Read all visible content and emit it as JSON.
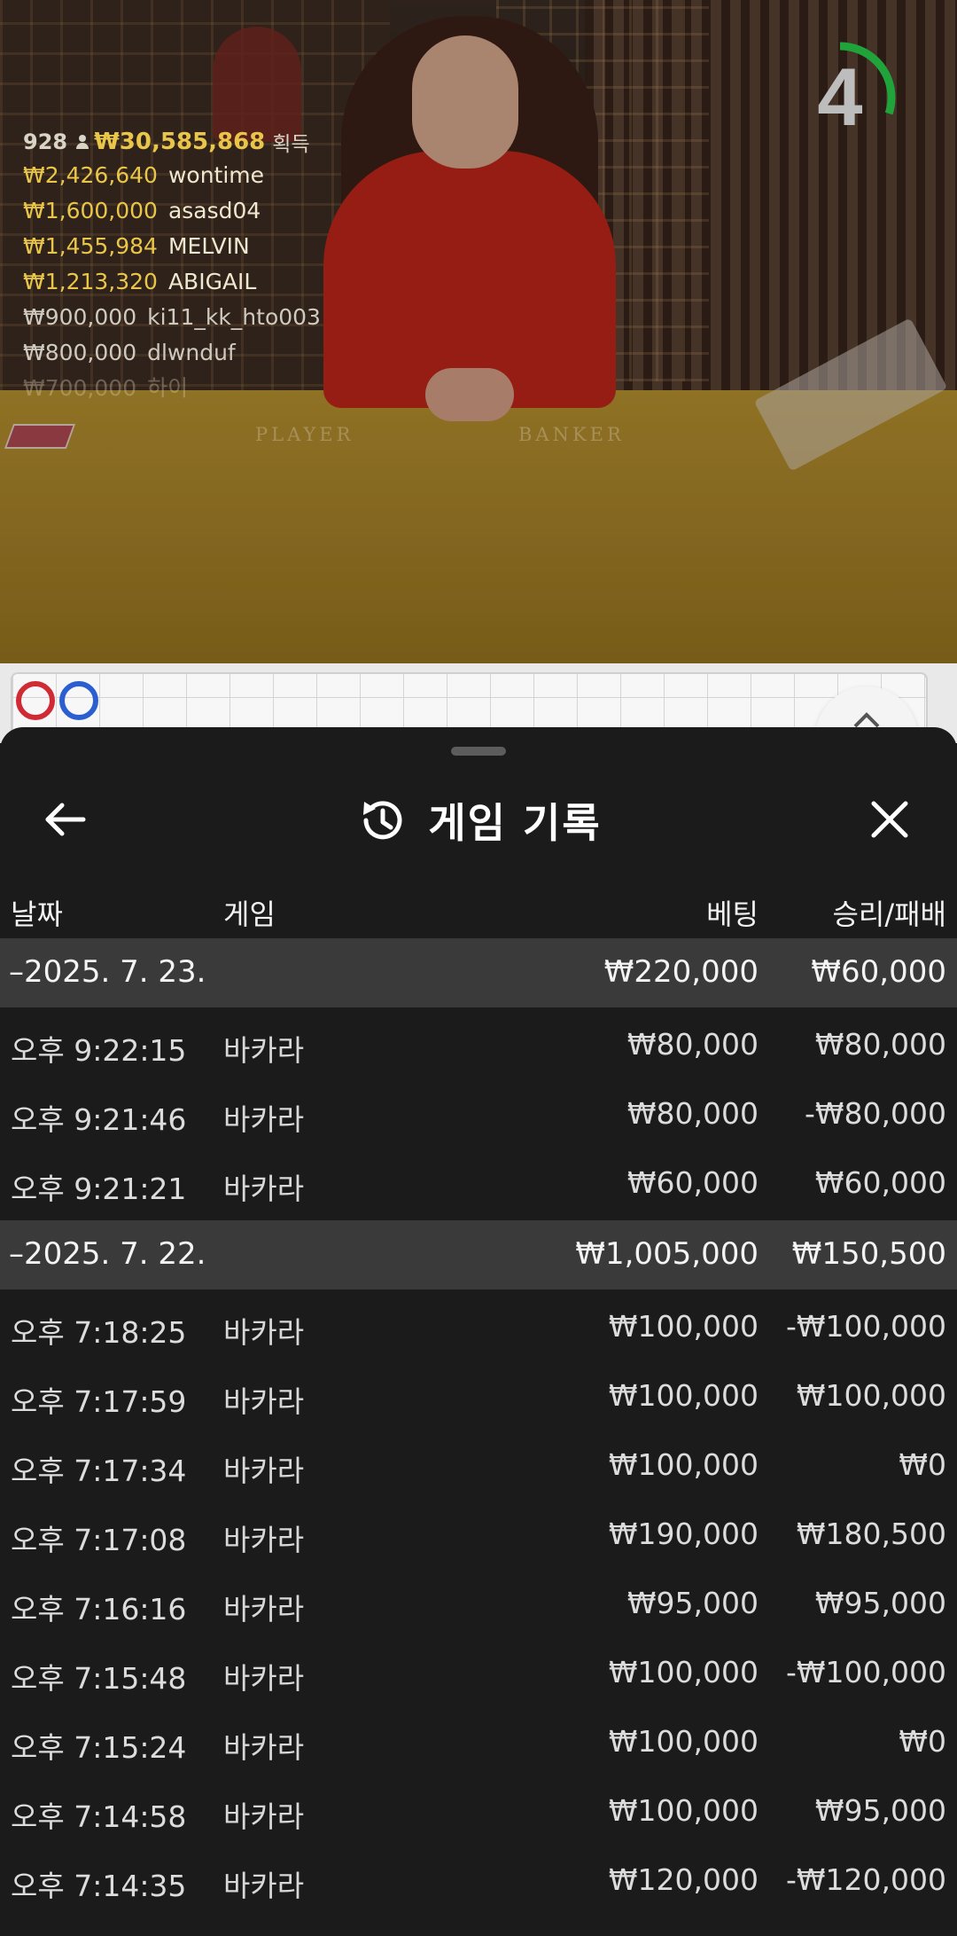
{
  "live": {
    "winners_count": "928",
    "winners_total": "₩30,585,868",
    "winners_suffix": "획득",
    "winners": [
      {
        "amount": "₩2,426,640",
        "name": "wontime"
      },
      {
        "amount": "₩1,600,000",
        "name": "asasd04"
      },
      {
        "amount": "₩1,455,984",
        "name": "MELVIN"
      },
      {
        "amount": "₩1,213,320",
        "name": "ABIGAIL"
      },
      {
        "amount": "₩900,000",
        "name": "ki11_kk_hto003"
      },
      {
        "amount": "₩800,000",
        "name": "dlwnduf"
      },
      {
        "amount": "₩700,000",
        "name": "하이"
      }
    ],
    "timer": "4",
    "timer_progress": 0.3,
    "table_labels": {
      "player": "PLAYER",
      "banker": "BANKER"
    }
  },
  "road": {
    "beads": [
      "player-red",
      "banker-blue"
    ],
    "expand_icon": "chevron-up-icon"
  },
  "sheet": {
    "title": "게임 기록",
    "icons": {
      "back": "arrow-left-icon",
      "title": "history-icon",
      "close": "close-icon"
    },
    "columns": {
      "date": "날짜",
      "game": "게임",
      "bet": "베팅",
      "result": "승리/패배"
    },
    "days": [
      {
        "date": "–2025. 7. 23.",
        "bet": "₩220,000",
        "result": "₩60,000",
        "records": [
          {
            "time": "오후 9:22:15",
            "game": "바카라",
            "bet": "₩80,000",
            "result": "₩80,000"
          },
          {
            "time": "오후 9:21:46",
            "game": "바카라",
            "bet": "₩80,000",
            "result": "-₩80,000"
          },
          {
            "time": "오후 9:21:21",
            "game": "바카라",
            "bet": "₩60,000",
            "result": "₩60,000"
          }
        ]
      },
      {
        "date": "–2025. 7. 22.",
        "bet": "₩1,005,000",
        "result": "₩150,500",
        "records": [
          {
            "time": "오후 7:18:25",
            "game": "바카라",
            "bet": "₩100,000",
            "result": "-₩100,000"
          },
          {
            "time": "오후 7:17:59",
            "game": "바카라",
            "bet": "₩100,000",
            "result": "₩100,000"
          },
          {
            "time": "오후 7:17:34",
            "game": "바카라",
            "bet": "₩100,000",
            "result": "₩0"
          },
          {
            "time": "오후 7:17:08",
            "game": "바카라",
            "bet": "₩190,000",
            "result": "₩180,500"
          },
          {
            "time": "오후 7:16:16",
            "game": "바카라",
            "bet": "₩95,000",
            "result": "₩95,000"
          },
          {
            "time": "오후 7:15:48",
            "game": "바카라",
            "bet": "₩100,000",
            "result": "-₩100,000"
          },
          {
            "time": "오후 7:15:24",
            "game": "바카라",
            "bet": "₩100,000",
            "result": "₩0"
          },
          {
            "time": "오후 7:14:58",
            "game": "바카라",
            "bet": "₩100,000",
            "result": "₩95,000"
          },
          {
            "time": "오후 7:14:35",
            "game": "바카라",
            "bet": "₩120,000",
            "result": "-₩120,000"
          }
        ]
      }
    ]
  },
  "colors": {
    "gold": "#e9c64a",
    "timer_ring": "#1fa33a",
    "sheet_bg": "#1b1b1b",
    "day_row_bg": "#3a3a3a",
    "player_red": "#d02b34",
    "banker_blue": "#2b5fd0"
  }
}
